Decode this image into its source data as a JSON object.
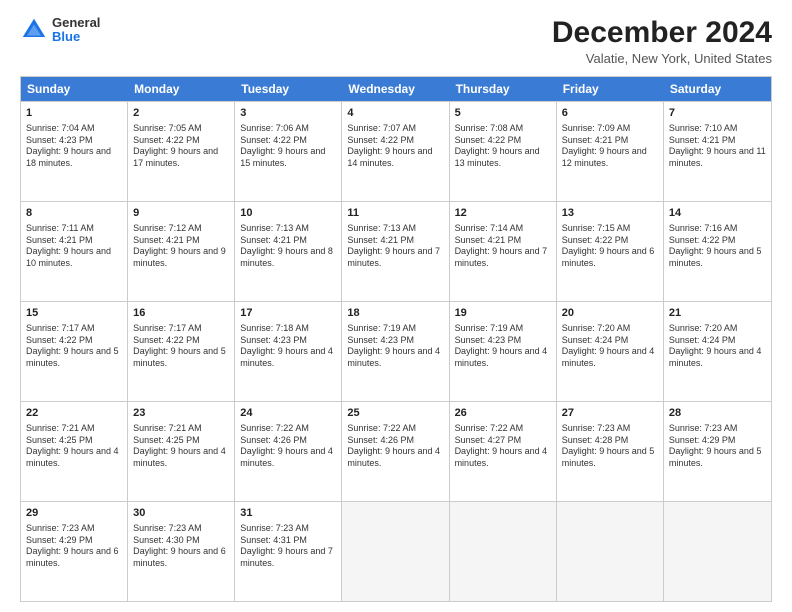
{
  "logo": {
    "general": "General",
    "blue": "Blue"
  },
  "title": "December 2024",
  "location": "Valatie, New York, United States",
  "days_of_week": [
    "Sunday",
    "Monday",
    "Tuesday",
    "Wednesday",
    "Thursday",
    "Friday",
    "Saturday"
  ],
  "weeks": [
    [
      {
        "day": 1,
        "sunrise": "Sunrise: 7:04 AM",
        "sunset": "Sunset: 4:23 PM",
        "daylight": "Daylight: 9 hours and 18 minutes."
      },
      {
        "day": 2,
        "sunrise": "Sunrise: 7:05 AM",
        "sunset": "Sunset: 4:22 PM",
        "daylight": "Daylight: 9 hours and 17 minutes."
      },
      {
        "day": 3,
        "sunrise": "Sunrise: 7:06 AM",
        "sunset": "Sunset: 4:22 PM",
        "daylight": "Daylight: 9 hours and 15 minutes."
      },
      {
        "day": 4,
        "sunrise": "Sunrise: 7:07 AM",
        "sunset": "Sunset: 4:22 PM",
        "daylight": "Daylight: 9 hours and 14 minutes."
      },
      {
        "day": 5,
        "sunrise": "Sunrise: 7:08 AM",
        "sunset": "Sunset: 4:22 PM",
        "daylight": "Daylight: 9 hours and 13 minutes."
      },
      {
        "day": 6,
        "sunrise": "Sunrise: 7:09 AM",
        "sunset": "Sunset: 4:21 PM",
        "daylight": "Daylight: 9 hours and 12 minutes."
      },
      {
        "day": 7,
        "sunrise": "Sunrise: 7:10 AM",
        "sunset": "Sunset: 4:21 PM",
        "daylight": "Daylight: 9 hours and 11 minutes."
      }
    ],
    [
      {
        "day": 8,
        "sunrise": "Sunrise: 7:11 AM",
        "sunset": "Sunset: 4:21 PM",
        "daylight": "Daylight: 9 hours and 10 minutes."
      },
      {
        "day": 9,
        "sunrise": "Sunrise: 7:12 AM",
        "sunset": "Sunset: 4:21 PM",
        "daylight": "Daylight: 9 hours and 9 minutes."
      },
      {
        "day": 10,
        "sunrise": "Sunrise: 7:13 AM",
        "sunset": "Sunset: 4:21 PM",
        "daylight": "Daylight: 9 hours and 8 minutes."
      },
      {
        "day": 11,
        "sunrise": "Sunrise: 7:13 AM",
        "sunset": "Sunset: 4:21 PM",
        "daylight": "Daylight: 9 hours and 7 minutes."
      },
      {
        "day": 12,
        "sunrise": "Sunrise: 7:14 AM",
        "sunset": "Sunset: 4:21 PM",
        "daylight": "Daylight: 9 hours and 7 minutes."
      },
      {
        "day": 13,
        "sunrise": "Sunrise: 7:15 AM",
        "sunset": "Sunset: 4:22 PM",
        "daylight": "Daylight: 9 hours and 6 minutes."
      },
      {
        "day": 14,
        "sunrise": "Sunrise: 7:16 AM",
        "sunset": "Sunset: 4:22 PM",
        "daylight": "Daylight: 9 hours and 5 minutes."
      }
    ],
    [
      {
        "day": 15,
        "sunrise": "Sunrise: 7:17 AM",
        "sunset": "Sunset: 4:22 PM",
        "daylight": "Daylight: 9 hours and 5 minutes."
      },
      {
        "day": 16,
        "sunrise": "Sunrise: 7:17 AM",
        "sunset": "Sunset: 4:22 PM",
        "daylight": "Daylight: 9 hours and 5 minutes."
      },
      {
        "day": 17,
        "sunrise": "Sunrise: 7:18 AM",
        "sunset": "Sunset: 4:23 PM",
        "daylight": "Daylight: 9 hours and 4 minutes."
      },
      {
        "day": 18,
        "sunrise": "Sunrise: 7:19 AM",
        "sunset": "Sunset: 4:23 PM",
        "daylight": "Daylight: 9 hours and 4 minutes."
      },
      {
        "day": 19,
        "sunrise": "Sunrise: 7:19 AM",
        "sunset": "Sunset: 4:23 PM",
        "daylight": "Daylight: 9 hours and 4 minutes."
      },
      {
        "day": 20,
        "sunrise": "Sunrise: 7:20 AM",
        "sunset": "Sunset: 4:24 PM",
        "daylight": "Daylight: 9 hours and 4 minutes."
      },
      {
        "day": 21,
        "sunrise": "Sunrise: 7:20 AM",
        "sunset": "Sunset: 4:24 PM",
        "daylight": "Daylight: 9 hours and 4 minutes."
      }
    ],
    [
      {
        "day": 22,
        "sunrise": "Sunrise: 7:21 AM",
        "sunset": "Sunset: 4:25 PM",
        "daylight": "Daylight: 9 hours and 4 minutes."
      },
      {
        "day": 23,
        "sunrise": "Sunrise: 7:21 AM",
        "sunset": "Sunset: 4:25 PM",
        "daylight": "Daylight: 9 hours and 4 minutes."
      },
      {
        "day": 24,
        "sunrise": "Sunrise: 7:22 AM",
        "sunset": "Sunset: 4:26 PM",
        "daylight": "Daylight: 9 hours and 4 minutes."
      },
      {
        "day": 25,
        "sunrise": "Sunrise: 7:22 AM",
        "sunset": "Sunset: 4:26 PM",
        "daylight": "Daylight: 9 hours and 4 minutes."
      },
      {
        "day": 26,
        "sunrise": "Sunrise: 7:22 AM",
        "sunset": "Sunset: 4:27 PM",
        "daylight": "Daylight: 9 hours and 4 minutes."
      },
      {
        "day": 27,
        "sunrise": "Sunrise: 7:23 AM",
        "sunset": "Sunset: 4:28 PM",
        "daylight": "Daylight: 9 hours and 5 minutes."
      },
      {
        "day": 28,
        "sunrise": "Sunrise: 7:23 AM",
        "sunset": "Sunset: 4:29 PM",
        "daylight": "Daylight: 9 hours and 5 minutes."
      }
    ],
    [
      {
        "day": 29,
        "sunrise": "Sunrise: 7:23 AM",
        "sunset": "Sunset: 4:29 PM",
        "daylight": "Daylight: 9 hours and 6 minutes."
      },
      {
        "day": 30,
        "sunrise": "Sunrise: 7:23 AM",
        "sunset": "Sunset: 4:30 PM",
        "daylight": "Daylight: 9 hours and 6 minutes."
      },
      {
        "day": 31,
        "sunrise": "Sunrise: 7:23 AM",
        "sunset": "Sunset: 4:31 PM",
        "daylight": "Daylight: 9 hours and 7 minutes."
      },
      null,
      null,
      null,
      null
    ]
  ]
}
